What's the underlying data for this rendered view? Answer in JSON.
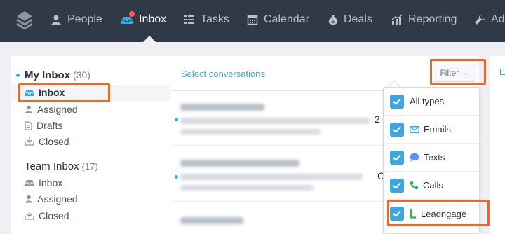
{
  "nav": {
    "items": [
      {
        "label": "People",
        "icon": "person-icon"
      },
      {
        "label": "Inbox",
        "icon": "inbox-icon",
        "active": true
      },
      {
        "label": "Tasks",
        "icon": "list-icon"
      },
      {
        "label": "Calendar",
        "icon": "calendar-icon"
      },
      {
        "label": "Deals",
        "icon": "money-bag-icon"
      },
      {
        "label": "Reporting",
        "icon": "bar-chart-icon"
      },
      {
        "label": "Ad",
        "icon": "wrench-icon"
      }
    ]
  },
  "sidebar": {
    "my_inbox": {
      "title": "My Inbox",
      "count": "(30)",
      "items": [
        {
          "label": "Inbox",
          "icon": "inbox-tray-icon"
        },
        {
          "label": "Assigned",
          "icon": "person-icon"
        },
        {
          "label": "Drafts",
          "icon": "document-icon"
        },
        {
          "label": "Closed",
          "icon": "closed-tray-icon"
        }
      ]
    },
    "team_inbox": {
      "title": "Team Inbox",
      "count": "(17)",
      "items": [
        {
          "label": "Inbox",
          "icon": "inbox-tray-icon"
        },
        {
          "label": "Assigned",
          "icon": "person-icon"
        },
        {
          "label": "Closed",
          "icon": "closed-tray-icon"
        }
      ]
    }
  },
  "main": {
    "select_label": "Select conversations",
    "filter_label": "Filter",
    "peek_chars": [
      "2",
      "C"
    ]
  },
  "filter_menu": {
    "items": [
      {
        "label": "All types",
        "icon": "",
        "checked": true
      },
      {
        "label": "Emails",
        "icon": "envelope-icon",
        "checked": true
      },
      {
        "label": "Texts",
        "icon": "speech-bubble-icon",
        "checked": true
      },
      {
        "label": "Calls",
        "icon": "phone-icon",
        "checked": true
      },
      {
        "label": "Leadngage",
        "icon": "leadngage-l-icon",
        "checked": true
      }
    ]
  },
  "colors": {
    "nav_bg": "#2f3a46",
    "accent": "#3aa7e0",
    "highlight": "#f26522",
    "phone_green": "#2fb34a",
    "badge_red": "#ff5a5f"
  }
}
